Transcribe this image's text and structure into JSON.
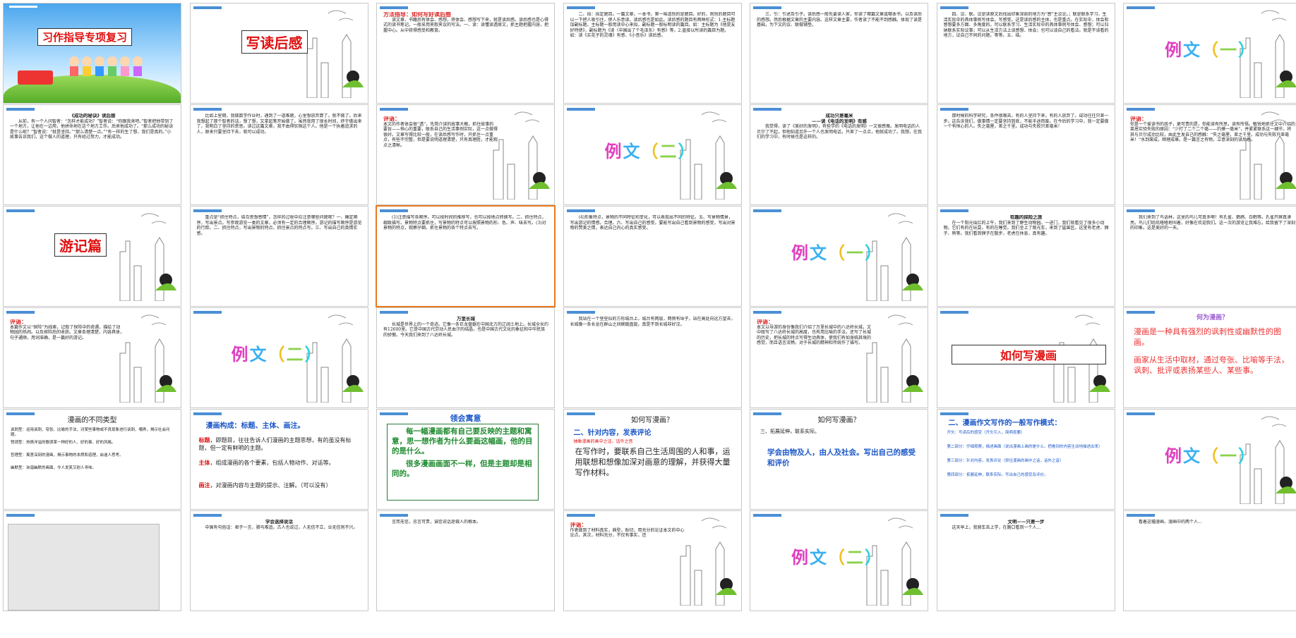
{
  "slides": [
    {
      "n": "1",
      "time": "00:00",
      "title": "习作指导专项复习",
      "kind": "cover"
    },
    {
      "n": "2",
      "time": "00:00",
      "title": "写读后感",
      "kind": "section"
    },
    {
      "n": "3",
      "time": "",
      "kind": "text",
      "heading": "方法指导：如何写好读后感",
      "text": "读文章、书籍后有体会、感想，将体会、感想写下来，就是读后感。读后感也是心得式的读书笔记。一般采用夹叙夹议的写法。一、读：读懂读透原文，抓主题把握内容，把握中心。从中获得感受和教育。"
    },
    {
      "n": "4",
      "time": "",
      "kind": "text",
      "text": "二、拟：拟定题目。一篇文章，一本书，第一味道别的是题目。好的，则别的题目可以一下把人吸引住，使人乐意读。读后感也是如此。读后感的题目有两种形式：1.主标题加副标题。主标题一般用读中心来拟，副标题一般标明读的篇目。如：主标题为《他是友好特使》，副标题为《读〈中国出了个毛泽东〉有感》等。2.直接以所读的篇目为题。如：读《买花子的灵魂》有感、《小音乐》读后感。"
    },
    {
      "n": "5",
      "time": "",
      "kind": "text",
      "text": "三、引：引述及引子。读后感一般先要读人家，你读了哪篇文章或哪本书，以及读后的感想。然后根据文章的主要内容。这样文章主要，作者读了不能不到感触。体现了读是基础，为下文的议、联做铺垫。"
    },
    {
      "n": "6",
      "time": "",
      "kind": "text",
      "text": "四、议、联。议是读原文后找出印象深刻的地方为“感”主议论。；联是联系学习、生活实际中的具体事例写体会。写感受。这是读后感的主体，也是重点。在实际中，体会和感想要多方面、多角度的。可以联系学习、生活实际中的具体事例写体会、感想；可以归纳联系实际议事；可以从生活方法上谈感想、体会；也可以谈自己的看法。就是不谈看的地方，议自己不同的问题。等等。五、结。"
    },
    {
      "n": "7",
      "time": "",
      "kind": "example",
      "label": "例文（一）"
    },
    {
      "n": "8",
      "time": "00:00",
      "kind": "text",
      "heading2": "《成功的秘诀》读后感",
      "text": "从前，有一个人问智者：“怎样才能成功？”智者说：“你跟我来吧。”智者把他带到了一个地方，让他在一边用，他拼命地在这个地方工作。后来他成功了。“那么成功的秘诀是什么呢？”智者说：“就是坚持。”“那么清楚一点。”“有一样的生了想，我们是真的。”小故事告诉我们，这个做人的道理，只有经过努力，才能成功。"
    },
    {
      "n": "9",
      "time": "00:00",
      "kind": "text",
      "text": "比如上星期，我做数学作业时，遇到了一道难题，心里想放弃算了。就不做了。后来我想起了那个智者的话，想了想，又拿起笔开始做了。虽然我用了很长时间，终于做出来了，我明白了坚持的意思。读过这篇文章，我不由得钦佩这个人。他是一个执着追求的人，原来只要坚持下去，就可以成功。"
    },
    {
      "n": "10",
      "time": "00:00",
      "kind": "comment",
      "label": "评语：",
      "text": "本文的作者体会很“透”，先简介读的故事大概，抓住故事的要旨——恒心的重要，联系自己的生活事例实际，这一点做得很好。文章写得比较一般，在读后感写作时，只抓住一点重点，有些不完整，但是要说明道理清楚，只有真理胜，才能观点之清晰。"
    },
    {
      "n": "11",
      "time": "00:00",
      "kind": "example",
      "label": "例文（二）"
    },
    {
      "n": "12",
      "time": "00:00",
      "kind": "text",
      "heading2": "成功只差毫米\n——读《电话的发明》有感",
      "text": "我觉得，读了《美好的发明》，有些学的《电话的发明》一文很感慨。发明电话的人贝尔了不起，但他知道另外一个人也发明电话，只差了一点点，他就成功了。我想，在我们的学习中，有时候也是这样的。"
    },
    {
      "n": "13",
      "time": "00:00",
      "kind": "text",
      "text": "那时候的科学研究，条件很艰苦，有的人坚持下来，有的人放弃了。成功往往只差一步。这告诉我们，做事情一定要坚持到底，不能半途而废。在今后的学习中，我一定要做一个有恒心的人。失之毫厘，差之千里。成功与失败只差毫米！"
    },
    {
      "n": "14",
      "time": "00:00",
      "kind": "comment",
      "label": "评语：",
      "text": "你是一个爱读书的孩子，更可贵的是，你能读有所思，读有所悟。敏锐地抓住文中介绍的莱恩实验失败的原因：“少打了二个二个毫——约摸一毫米”，并紧紧联系这一细节，将其与贝尔成功比较，由此生发自己的感触：“失之毫厘，差之千里。成功与失败只差毫米！”水到渠成，顺理成章。是一篇言之有物，立意深刻的读后感。"
    },
    {
      "n": "15",
      "time": "00:00",
      "title": "游记篇",
      "kind": "section"
    },
    {
      "n": "16",
      "time": "00:00",
      "kind": "text",
      "text": "重点是“抓住特点，结合思想感情”，怎样的过程中应注意哪些问题呢？一、确定顺序，写出景点。写参观游览一类的文章，必须有一定的合理顺序。游记的描写顺序是游览的行踪。二、抓住特点，写出景物的特点，抓住景点的特点写。三、写出自己的真情实感。"
    },
    {
      "n": "17",
      "time": "00:00",
      "kind": "text",
      "selected": true,
      "text": "(1)注意描写各顺序。可以按时间的推移写，也可以按地点转换写。二、抓住特点，细致描写。景物特点要抓住，写景物的特点可以按照景物的形、色、声、味去写。(3)对景物的特点，观察仔细，抓住景物的各个特点去写。"
    },
    {
      "n": "18",
      "time": "00:00",
      "kind": "text",
      "text": "(4)形象特点，景物的不同特征和变化，可以表现出不同的特征。五、写景物情景，写出游记的情感。合理。六、写出自己的感受。要能写出自己看到景物的感受，写出对景物的赞美之情，表达自己内心的真实感受。"
    },
    {
      "n": "19",
      "time": "00:00",
      "kind": "example",
      "label": "例文（一）"
    },
    {
      "n": "20",
      "time": "00:00",
      "kind": "text",
      "heading2": "有趣的探险之旅",
      "text": "在一个阳光灿烂的上午，我们来到了野生动物园。一进门，我们就看见了很多小动物。它们有的在玩耍，有的在睡觉。我们坐上了观光车，来到了猛兽区。这里有老虎、狮子、熊等。我们看到狮子在散步，老虎在休息，真有趣。"
    },
    {
      "n": "21",
      "time": "00:00",
      "kind": "text",
      "text": "我们来到了鸟语林，这里的鸟儿可真多啊！有孔雀、鹦鹉、白鹤等。孔雀开屏真漂亮。鸟儿们叽叽喳喳地叫着，好像在欢迎我们。这一次的游览让我难忘，给我留下了深刻的印象。这是美好的一天。"
    },
    {
      "n": "22",
      "time": "00:00",
      "kind": "comment",
      "label": "评语：",
      "text": "本篇作文以“探险”为线索，记叙了探险中的奇遇，描绘了动物园的热闹。以及探险后的收获。文章条理清楚，内容具体，句子通顺，用词准确，是一篇好的游记。"
    },
    {
      "n": "23",
      "time": "",
      "kind": "example",
      "label": "例文（二）"
    },
    {
      "n": "24",
      "time": "",
      "kind": "text",
      "heading2": "万里长城",
      "text": "长城是世界上的一个奇迹。它像一条巨龙盘踞在中国北方的辽阔土地上。长城全长约有12600里。它是中国古代劳动人民血汗的结晶，也是中国古代文化的象征和中华民族的骄傲。今天我们来到了八达岭长城。"
    },
    {
      "n": "25",
      "time": "00:00",
      "kind": "text",
      "text": "我站在一个堡垒似的方形城台上，城台有两层，两侧有垛子，站在高处向远方望去，长城像一条长龙在群山之间蜿蜒盘旋。真是不到长城非好汉。"
    },
    {
      "n": "26",
      "time": "00:00",
      "kind": "comment",
      "label": "评语：",
      "text": "本文以导游的身份像我们介绍了万里长城中的八达岭长城，文中既写了八达岭长城的高度，也有用比喻的手法，还写了长城的历史，把长城的特点写得生动具体，使我们有如身临其境的感觉，而且语言流畅，对于长城的精神和传统作了描写。"
    },
    {
      "n": "27",
      "time": "00:00",
      "kind": "section-box",
      "title": "如何写漫画"
    },
    {
      "n": "28",
      "time": "",
      "kind": "bullets",
      "heading": "何为漫画？",
      "items": [
        "漫画是一种具有强烈的讽刺性或幽默性的图画。",
        "画家从生活中取材，通过夸张、比喻等手法，讽刺、批评或表扬某些人、某些事。"
      ]
    },
    {
      "n": "29",
      "time": "",
      "kind": "list",
      "heading": "漫画的不同类型",
      "items": [
        "讽刺型：运用讽刺、夸张、比喻的手法，对某些事物或不良现象进行讽刺、嘲弄，揭示社会问题。",
        "赞颂型：热情洋溢的歌颂某一种好的人、好的事、好的风格。",
        "哲理型：寓意深刻的漫画，揭示事物的本质和道理，启迪人思考。",
        "幽默型：诙谐幽默的画面，令人发笑又耐人寻味。"
      ]
    },
    {
      "n": "30",
      "time": "",
      "kind": "comic",
      "heading": "漫画构成：标题、主体、画注。",
      "lines": [
        [
          "标题",
          "，即题目，往往告诉人们漫画的主题思想，有的虽没有标题，但一定有鲜明的主题。"
        ],
        [
          "主体",
          "，组成漫画的各个要素，包括人物动作、对话等。"
        ],
        [
          "画注",
          "，对漫画内容与主题的提示、注解。（可以没有）"
        ]
      ]
    },
    {
      "n": "31",
      "time": "",
      "kind": "meaning",
      "heading": "领会寓意",
      "p1": "每一幅漫画都有自己要反映的主题和寓意，思一想作者为什么要画这幅画，他的目的是什么。",
      "p2": "很多漫画画面不一样，但是主题却是相同的。"
    },
    {
      "n": "32",
      "time": "",
      "kind": "how",
      "heading": "如何写漫画？",
      "sub": "二、针对内容，发表评论",
      "red": "抽象漫画的画中之话，话外之音",
      "text": "在写作时，要联系自己生活周围的人和事，运用联想和想像加深对画意的理解，并获得大量写作材料。"
    },
    {
      "n": "33",
      "time": "",
      "kind": "how2",
      "heading": "如何写漫画？",
      "sub": "三、拓展延伸，联系实际。",
      "text": "学会由物及人，由人及社会。写出自己的感受和评价"
    },
    {
      "n": "34",
      "time": "",
      "kind": "mode",
      "heading": "二、漫画作文写作的一般写作模式：",
      "items": [
        "开头：写读后的感受（开头引入，简明扼要）",
        "第二部分：仔细观察，描述画面（说出漫画上画的是什么，把看到的内容生动地描述出来）",
        "第三部分：针对内容，发表评论（抓住漫画的画中之话，话外之音）",
        "第四部分：拓展延伸，联系实际。写出自己的感受及评价。"
      ]
    },
    {
      "n": "35",
      "time": "",
      "kind": "example",
      "label": "例文（一）"
    }
  ],
  "row6": [
    {
      "kind": "image"
    },
    {
      "kind": "text",
      "heading2": "学会选择说话",
      "text": "中国有句俗话：君子一言，驷马难追。古人也说过，人无信不立，业无信则不兴。"
    },
    {
      "kind": "text",
      "text": "言而无信，忠言可贵，诚信说话是做人的根本。"
    },
    {
      "kind": "comment",
      "label": "评语：",
      "text": "作者做到了材料真实，典型，贴切，用充分的论证本文的中心论点，其次，材料充分，不仅有事实，还"
    },
    {
      "kind": "example",
      "label": "例文（二）"
    },
    {
      "kind": "text",
      "heading2": "文明——只差一步",
      "text": "这天早上，我骑车去上学，在路口看到一个人..."
    },
    {
      "kind": "text",
      "text": "看着这幅漫画，漫画中的两个人..."
    }
  ],
  "colors": {
    "accent": "#e8791e",
    "link_blue": "#1b57c9",
    "title_red": "#e01010"
  }
}
